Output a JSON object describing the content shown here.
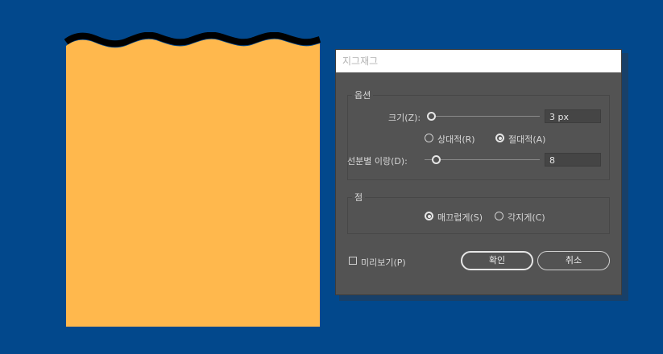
{
  "dialog": {
    "title": "지그재그",
    "options_group": {
      "label": "옵션",
      "size_label": "크기(Z):",
      "size_value": "3 px",
      "size_slider_fraction": 0.0,
      "relative_label": "상대적(R)",
      "absolute_label": "절대적(A)",
      "mode_selected": "absolute",
      "ridges_label": "선분별 이랑(D):",
      "ridges_value": "8",
      "ridges_slider_fraction": 0.0
    },
    "points_group": {
      "label": "점",
      "smooth_label": "매끄럽게(S)",
      "corner_label": "각지게(C)",
      "selected": "smooth"
    },
    "preview_label": "미리보기(P)",
    "preview_checked": false,
    "ok_label": "확인",
    "cancel_label": "취소"
  },
  "colors": {
    "background": "#02488c",
    "shape_fill": "#ffb84d",
    "shape_stroke": "#000000",
    "dialog_bg": "#535353",
    "title_bg": "#ffffff"
  }
}
